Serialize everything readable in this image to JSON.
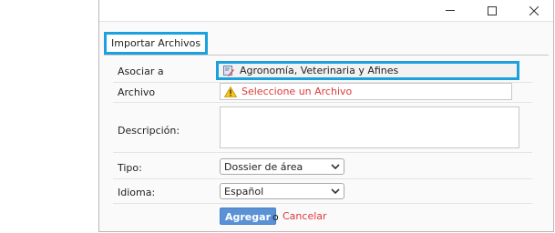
{
  "window": {
    "controls": {
      "minimize_icon": "minimize-icon",
      "maximize_icon": "maximize-icon",
      "close_icon": "close-icon"
    }
  },
  "tab": {
    "label": "Importar Archivos"
  },
  "form": {
    "asociar": {
      "label": "Asociar a",
      "value": "Agronomía, Veterinaria y Afines",
      "icon": "edit-pencil-icon"
    },
    "archivo": {
      "label": "Archivo",
      "value": "Seleccione un Archivo",
      "icon": "warning-icon",
      "value_color": "#e0383a"
    },
    "descripcion": {
      "label": "Descripción:",
      "value": ""
    },
    "tipo": {
      "label": "Tipo:",
      "selected": "Dossier de área"
    },
    "idioma": {
      "label": "Idioma:",
      "selected": "Español"
    },
    "actions": {
      "submit": "Agregar",
      "separator": "o",
      "cancel": "Cancelar"
    }
  },
  "colors": {
    "highlight": "#1ba1dd",
    "primary_button": "#5b92d6",
    "danger_text": "#e0383a"
  }
}
